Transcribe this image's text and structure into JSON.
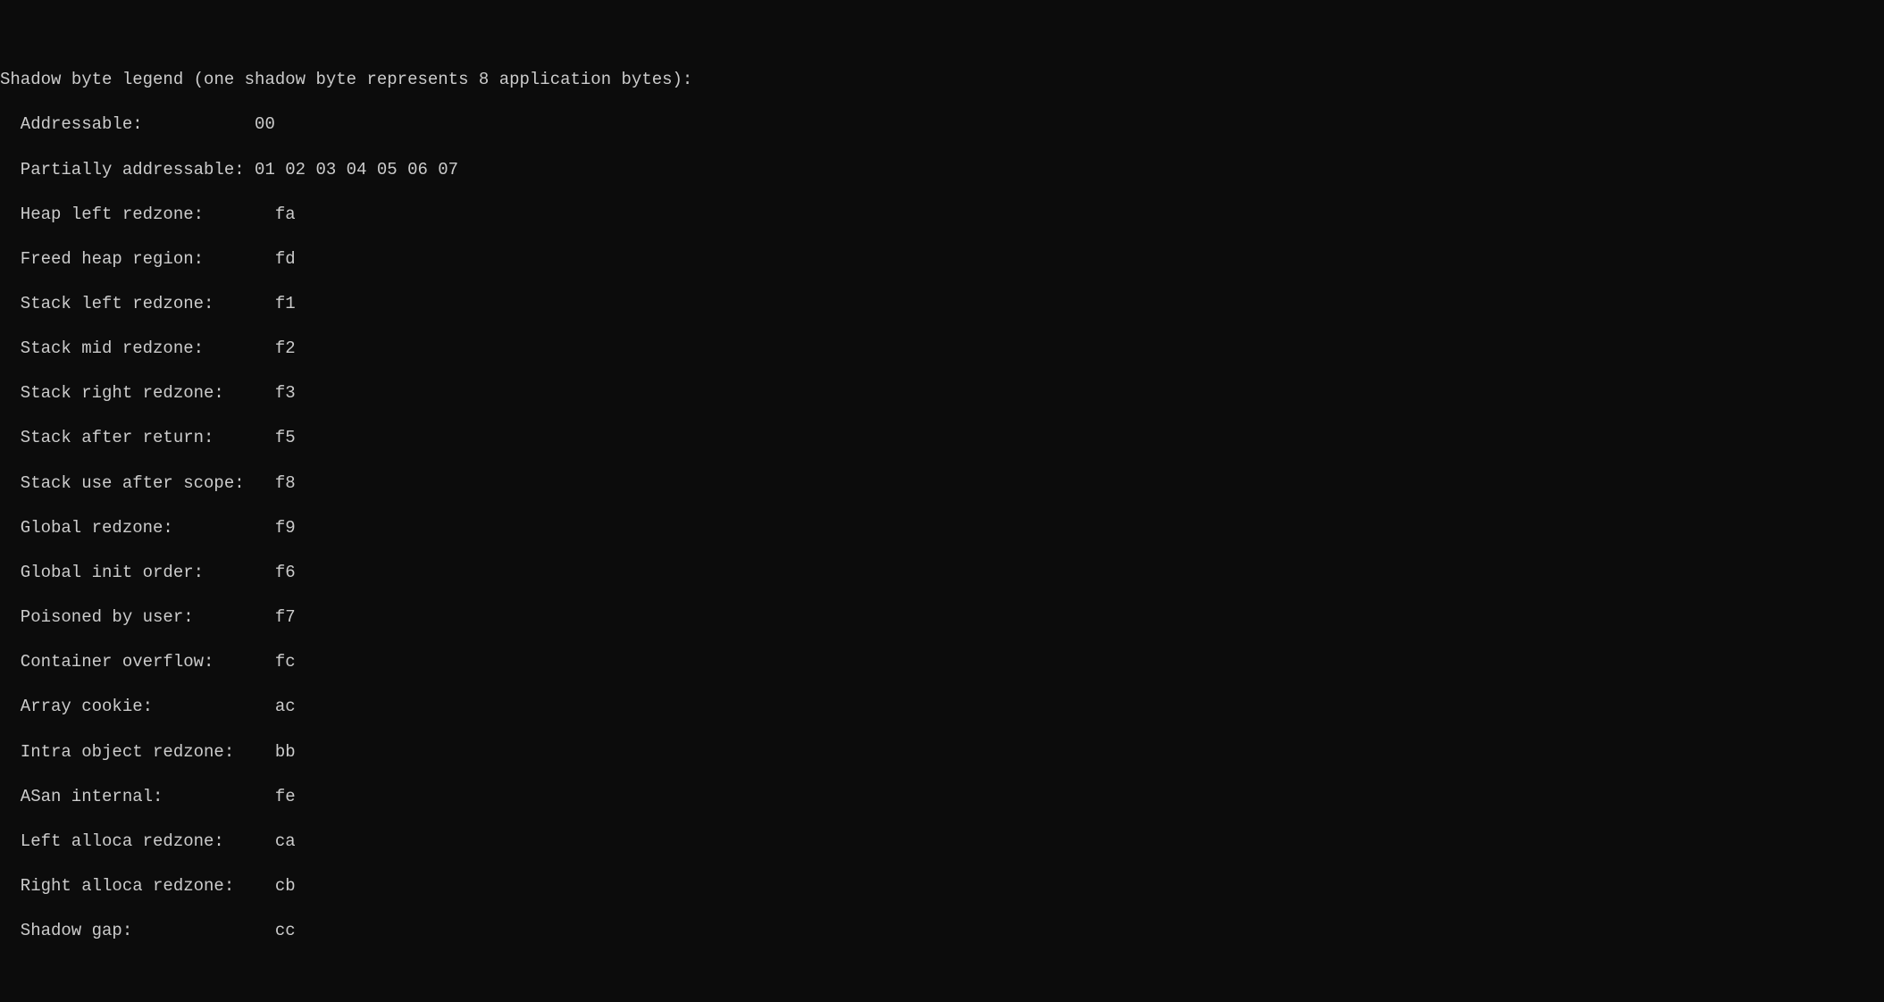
{
  "legend": {
    "header": "Shadow byte legend (one shadow byte represents 8 application bytes):",
    "rows": [
      {
        "label": "Addressable:           ",
        "value": "00"
      },
      {
        "label": "Partially addressable: ",
        "value": "01 02 03 04 05 06 07"
      },
      {
        "label": "Heap left redzone:       ",
        "value": "fa"
      },
      {
        "label": "Freed heap region:       ",
        "value": "fd"
      },
      {
        "label": "Stack left redzone:      ",
        "value": "f1"
      },
      {
        "label": "Stack mid redzone:       ",
        "value": "f2"
      },
      {
        "label": "Stack right redzone:     ",
        "value": "f3"
      },
      {
        "label": "Stack after return:      ",
        "value": "f5"
      },
      {
        "label": "Stack use after scope:   ",
        "value": "f8"
      },
      {
        "label": "Global redzone:          ",
        "value": "f9"
      },
      {
        "label": "Global init order:       ",
        "value": "f6"
      },
      {
        "label": "Poisoned by user:        ",
        "value": "f7"
      },
      {
        "label": "Container overflow:      ",
        "value": "fc"
      },
      {
        "label": "Array cookie:            ",
        "value": "ac"
      },
      {
        "label": "Intra object redzone:    ",
        "value": "bb"
      },
      {
        "label": "ASan internal:           ",
        "value": "fe"
      },
      {
        "label": "Left alloca redzone:     ",
        "value": "ca"
      },
      {
        "label": "Right alloca redzone:    ",
        "value": "cb"
      },
      {
        "label": "Shadow gap:              ",
        "value": "cc"
      }
    ]
  }
}
